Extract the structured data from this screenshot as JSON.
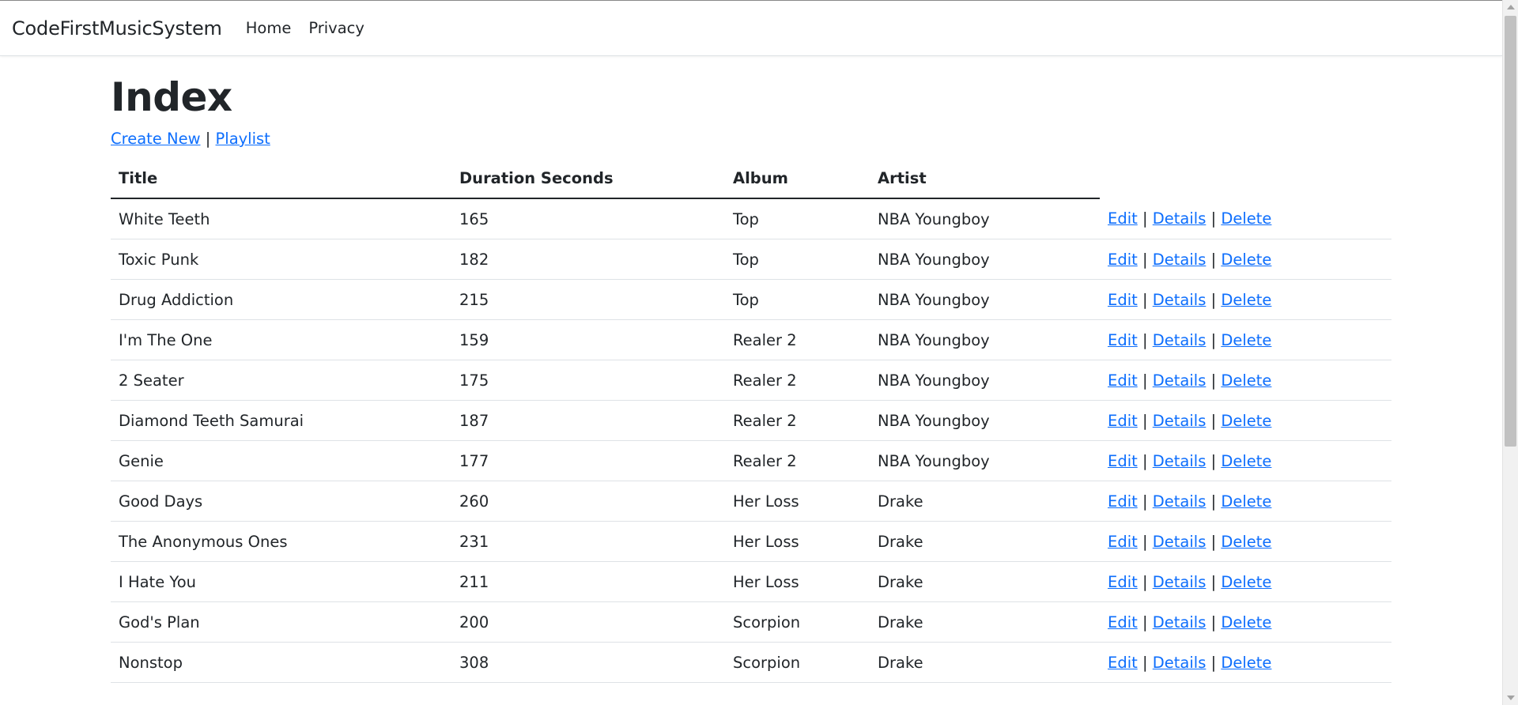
{
  "navbar": {
    "brand": "CodeFirstMusicSystem",
    "links": [
      "Home",
      "Privacy"
    ]
  },
  "page": {
    "title": "Index",
    "create_new": "Create New",
    "separator": "|",
    "playlist": "Playlist"
  },
  "table": {
    "headers": [
      "Title",
      "Duration Seconds",
      "Album",
      "Artist"
    ],
    "row_actions": [
      "Edit",
      "Details",
      "Delete"
    ],
    "rows": [
      {
        "title": "White Teeth",
        "duration": "165",
        "album": "Top",
        "artist": "NBA Youngboy"
      },
      {
        "title": "Toxic Punk",
        "duration": "182",
        "album": "Top",
        "artist": "NBA Youngboy"
      },
      {
        "title": "Drug Addiction",
        "duration": "215",
        "album": "Top",
        "artist": "NBA Youngboy"
      },
      {
        "title": "I'm The One",
        "duration": "159",
        "album": "Realer 2",
        "artist": "NBA Youngboy"
      },
      {
        "title": "2 Seater",
        "duration": "175",
        "album": "Realer 2",
        "artist": "NBA Youngboy"
      },
      {
        "title": "Diamond Teeth Samurai",
        "duration": "187",
        "album": "Realer 2",
        "artist": "NBA Youngboy"
      },
      {
        "title": "Genie",
        "duration": "177",
        "album": "Realer 2",
        "artist": "NBA Youngboy"
      },
      {
        "title": "Good Days",
        "duration": "260",
        "album": "Her Loss",
        "artist": "Drake"
      },
      {
        "title": "The Anonymous Ones",
        "duration": "231",
        "album": "Her Loss",
        "artist": "Drake"
      },
      {
        "title": "I Hate You",
        "duration": "211",
        "album": "Her Loss",
        "artist": "Drake"
      },
      {
        "title": "God's Plan",
        "duration": "200",
        "album": "Scorpion",
        "artist": "Drake"
      },
      {
        "title": "Nonstop",
        "duration": "308",
        "album": "Scorpion",
        "artist": "Drake"
      }
    ]
  },
  "colors": {
    "link": "#0d6efd",
    "text": "#212529",
    "row_border": "#dee2e6"
  }
}
